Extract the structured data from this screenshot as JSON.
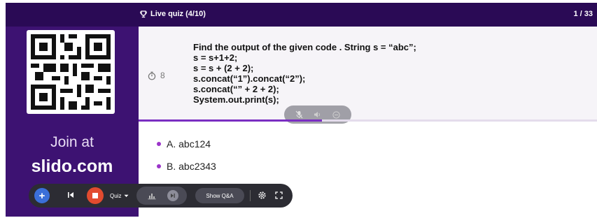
{
  "header": {
    "live_label": "Live quiz (4/10)",
    "counter": "1 / 33"
  },
  "sidebar": {
    "join_label": "Join at",
    "domain": "slido.com"
  },
  "question": {
    "timer_value": "8",
    "lines": [
      "Find the output of the given code . String s = “abc”;",
      "s = s+1+2;",
      "s = s + (2 + 2);",
      "s.concat(“1”).concat(“2”);",
      "s.concat(“” + 2 + 2);",
      "System.out.print(s);"
    ],
    "progress": 0.4
  },
  "options": [
    {
      "label": "A. abc124"
    },
    {
      "label": "B. abc2343"
    }
  ],
  "toolbar": {
    "quiz_label": "Quiz",
    "show_qa_label": "Show Q&A"
  },
  "colors": {
    "background": "#3d1272",
    "accent": "#7a2ec2",
    "bullet": "#9b34c9",
    "stop_button": "#e24b2f",
    "add_button": "#3b6fd8"
  }
}
